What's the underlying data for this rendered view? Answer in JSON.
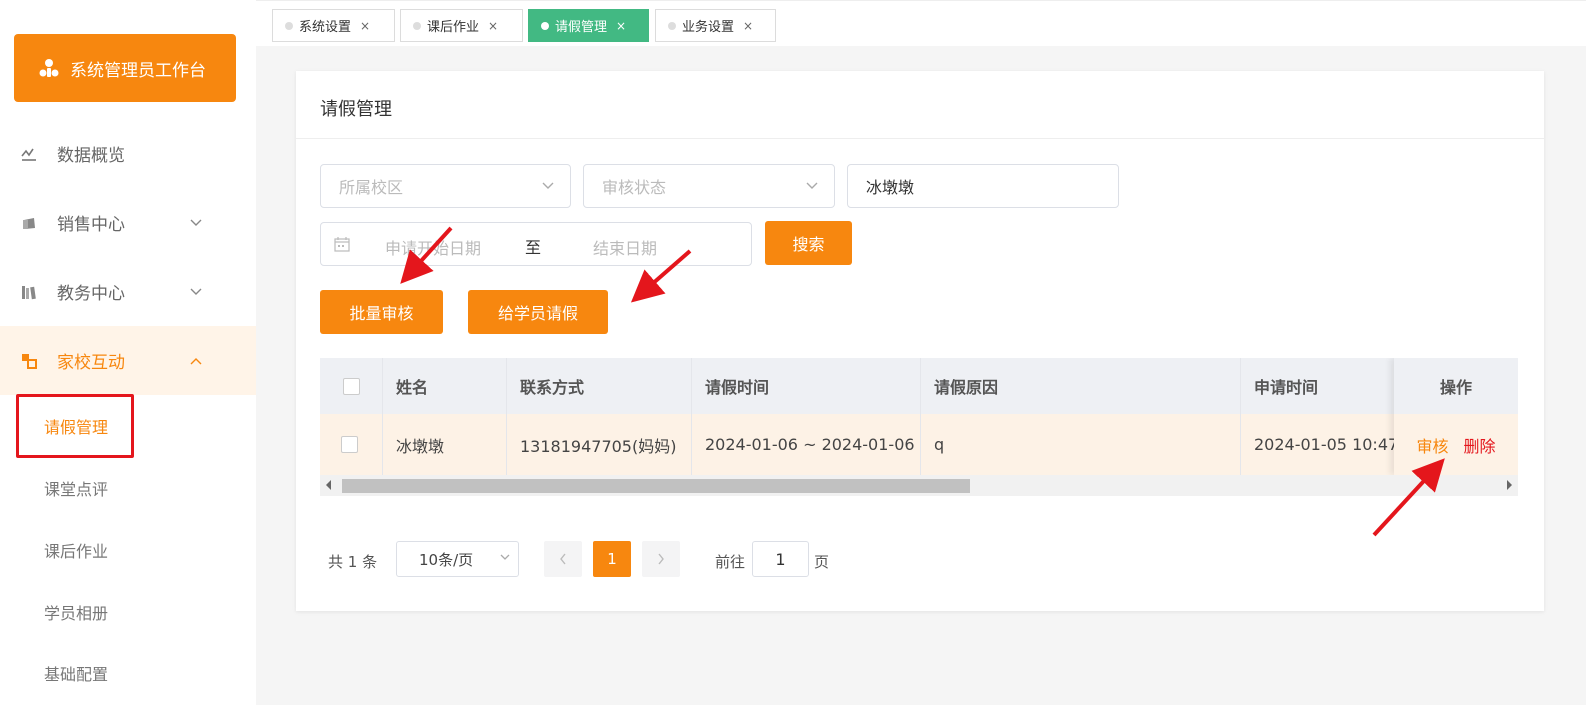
{
  "sidebar": {
    "brand_label": "系统管理员工作台",
    "items": [
      {
        "label": "数据概览",
        "icon": "chart-line-icon"
      },
      {
        "label": "销售中心",
        "icon": "bag-icon"
      },
      {
        "label": "教务中心",
        "icon": "books-icon"
      },
      {
        "label": "家校互动",
        "icon": "interaction-icon"
      }
    ],
    "sub_items": [
      {
        "label": "请假管理",
        "active": true
      },
      {
        "label": "课堂点评"
      },
      {
        "label": "课后作业"
      },
      {
        "label": "学员相册"
      },
      {
        "label": "基础配置"
      }
    ]
  },
  "tabs": [
    {
      "label": "系统设置",
      "active": false
    },
    {
      "label": "课后作业",
      "active": false
    },
    {
      "label": "请假管理",
      "active": true
    },
    {
      "label": "业务设置",
      "active": false
    }
  ],
  "page": {
    "title": "请假管理",
    "filters": {
      "campus_placeholder": "所属校区",
      "status_placeholder": "审核状态",
      "name_value": "冰墩墩",
      "start_date_placeholder": "申请开始日期",
      "date_separator": "至",
      "end_date_placeholder": "结束日期",
      "search_label": "搜索"
    },
    "actions": {
      "batch_audit_label": "批量审核",
      "leave_for_student_label": "给学员请假"
    },
    "table": {
      "headers": [
        "姓名",
        "联系方式",
        "请假时间",
        "请假原因",
        "申请时间",
        "操作"
      ],
      "rows": [
        {
          "name": "冰墩墩",
          "contact": "13181947705(妈妈)",
          "leave_time": "2024-01-06 ~ 2024-01-06",
          "reason": "q",
          "apply_time": "2024-01-05 10:47",
          "audit_label": "审核",
          "delete_label": "删除"
        }
      ]
    },
    "pagination": {
      "total_text": "共 1 条",
      "page_size": "10条/页",
      "current_page": "1",
      "goto_label": "前往",
      "goto_value": "1",
      "page_suffix": "页"
    }
  },
  "colors": {
    "accent": "#f7870f",
    "tab_active": "#42b983",
    "danger": "#e4161c"
  }
}
